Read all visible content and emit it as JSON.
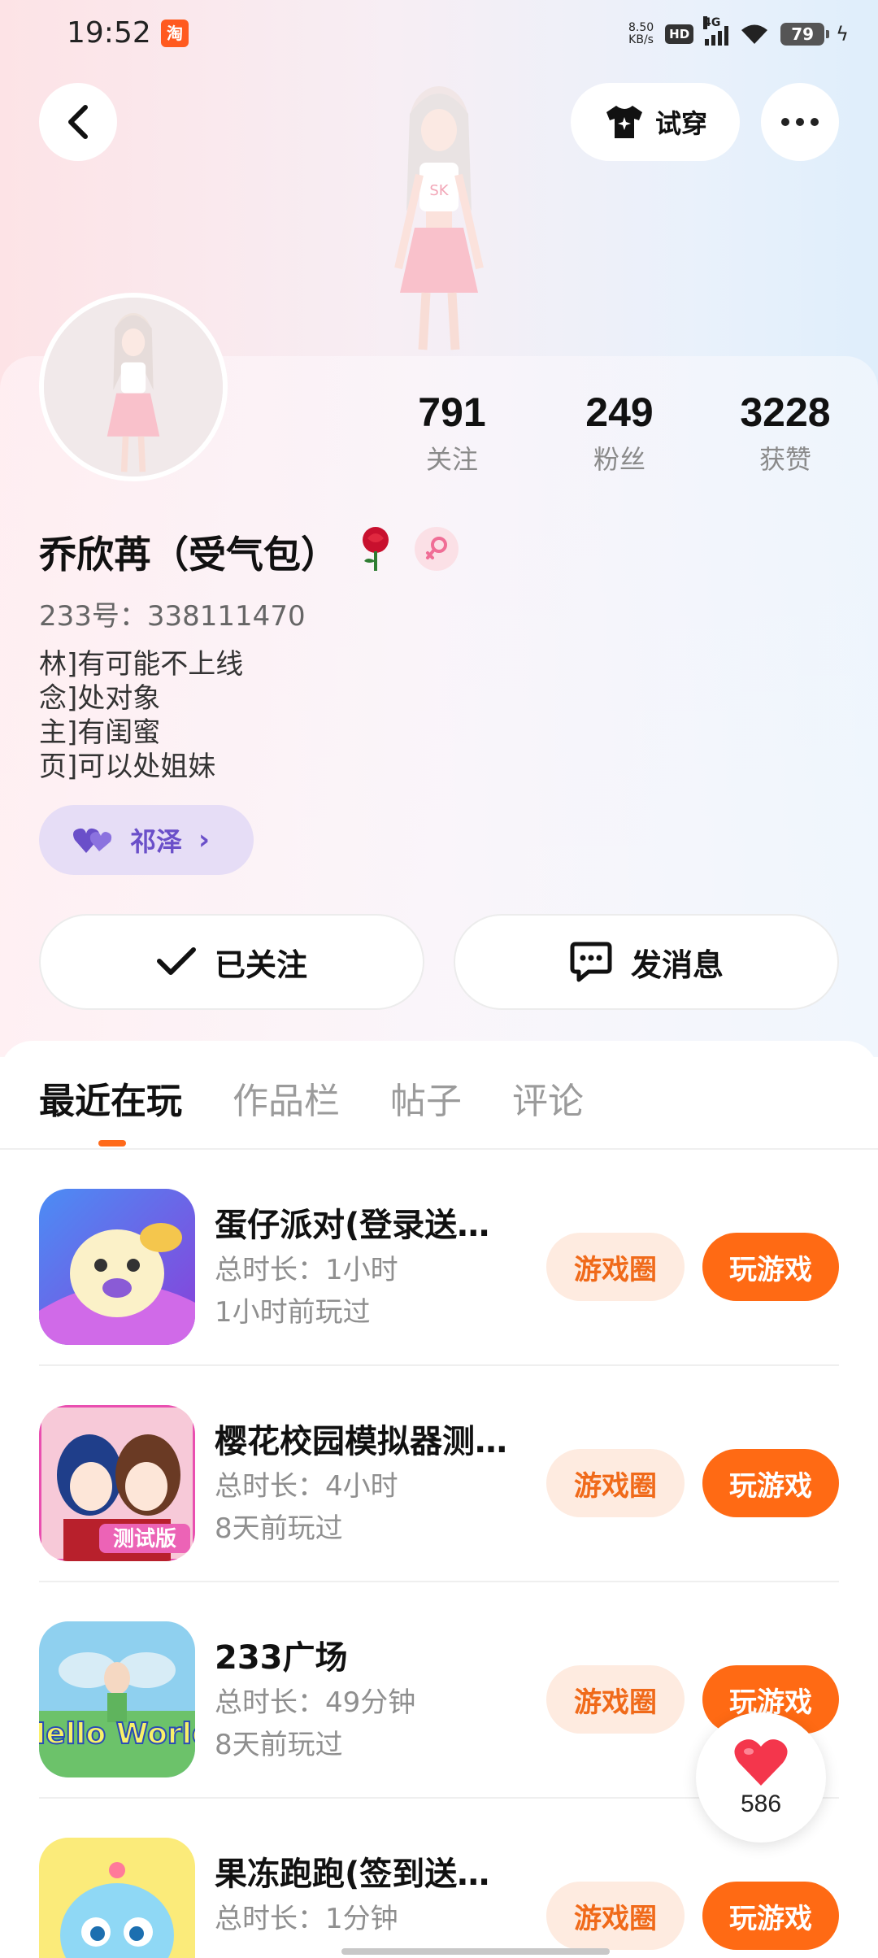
{
  "status_bar": {
    "time": "19:52",
    "app_icon": "taobao-icon",
    "net_speed_value": "8.50",
    "net_speed_unit": "KB/s",
    "hd": "HD",
    "network": "4G",
    "battery": "79"
  },
  "header": {
    "back_icon": "chevron-left-icon",
    "tryon_label": "试穿",
    "more_icon": "more-icon"
  },
  "profile": {
    "stats": [
      {
        "value": "791",
        "label": "关注"
      },
      {
        "value": "249",
        "label": "粉丝"
      },
      {
        "value": "3228",
        "label": "获赞"
      }
    ],
    "name": "乔欣苒（受气包）",
    "id_text": "233号：338111470",
    "bio_lines": [
      "林]有可能不上线",
      "念]处对象",
      "主]有闺蜜",
      "页]可以处姐妹"
    ],
    "cp_name": "祁泽",
    "follow_label": "已关注",
    "message_label": "发消息"
  },
  "tabs": [
    "最近在玩",
    "作品栏",
    "帖子",
    "评论"
  ],
  "games": [
    {
      "title": "蛋仔派对(登录送…",
      "duration": "总时长：1小时",
      "last_played": "1小时前玩过",
      "circle_label": "游戏圈",
      "play_label": "玩游戏"
    },
    {
      "title": "樱花校园模拟器测…",
      "duration": "总时长：4小时",
      "last_played": "8天前玩过",
      "circle_label": "游戏圈",
      "play_label": "玩游戏"
    },
    {
      "title": "233广场",
      "duration": "总时长：49分钟",
      "last_played": "8天前玩过",
      "circle_label": "游戏圈",
      "play_label": "玩游戏"
    },
    {
      "title": "果冻跑跑(签到送…",
      "duration": "总时长：1分钟",
      "last_played": "",
      "circle_label": "游戏圈",
      "play_label": "玩游戏"
    }
  ],
  "game_icon_texts": {
    "testing_badge": "测试版",
    "hello_world": "Hello World"
  },
  "like_float": {
    "count": "586"
  },
  "colors": {
    "accent": "#ff6a14",
    "accent_light": "#feebe0",
    "cp_purple": "#6a4fc9"
  }
}
